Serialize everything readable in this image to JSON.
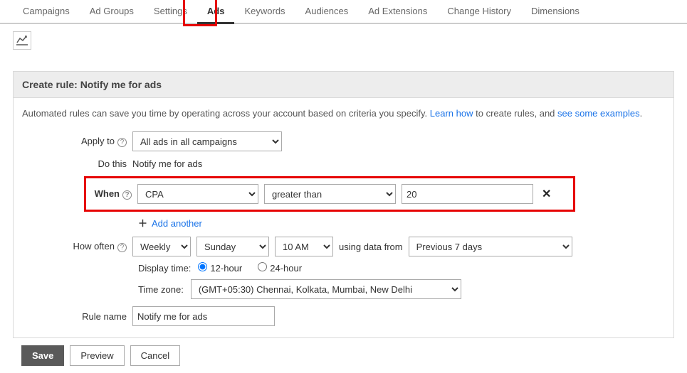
{
  "tabs": {
    "campaigns": "Campaigns",
    "ad_groups": "Ad Groups",
    "settings": "Settings",
    "ads": "Ads",
    "keywords": "Keywords",
    "audiences": "Audiences",
    "ad_extensions": "Ad Extensions",
    "change_history": "Change History",
    "dimensions": "Dimensions"
  },
  "panel": {
    "title": "Create rule: Notify me for ads",
    "desc_prefix": "Automated rules can save you time by operating across your account based on criteria you specify. ",
    "link_learn": "Learn how",
    "desc_mid": " to create rules, and ",
    "link_examples": "see some examples",
    "desc_suffix": "."
  },
  "labels": {
    "apply_to": "Apply to",
    "do_this": "Do this",
    "when": "When",
    "how_often": "How often",
    "rule_name": "Rule name",
    "display_time": "Display time:",
    "time_zone": "Time zone:",
    "using_data_from": "using data from",
    "twelve_hr": "12-hour",
    "twenty_four_hr": "24-hour",
    "add_another": "Add another"
  },
  "values": {
    "apply_to": "All ads in all campaigns",
    "do_this": "Notify me for ads",
    "when_metric": "CPA",
    "when_op": "greater than",
    "when_value": "20",
    "freq": "Weekly",
    "day": "Sunday",
    "time": "10 AM",
    "data_range": "Previous 7 days",
    "timezone": "(GMT+05:30) Chennai, Kolkata, Mumbai, New Delhi",
    "rule_name": "Notify me for ads"
  },
  "buttons": {
    "save": "Save",
    "preview": "Preview",
    "cancel": "Cancel"
  }
}
